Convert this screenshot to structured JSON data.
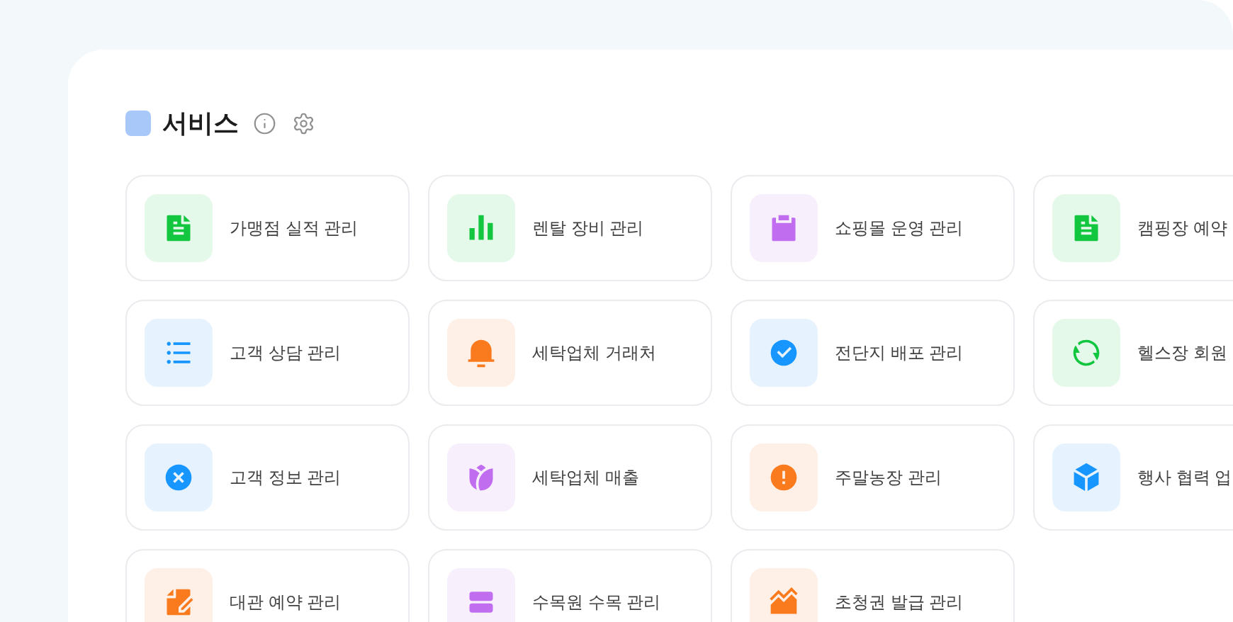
{
  "section": {
    "title": "서비스"
  },
  "services": [
    {
      "label": "가맹점 실적 관리",
      "kind": "document",
      "color": "#12c73f"
    },
    {
      "label": "렌탈 장비 관리",
      "kind": "bars",
      "color": "#12c73f"
    },
    {
      "label": "쇼핑몰 운영 관리",
      "kind": "clipboard",
      "color": "#c06df0"
    },
    {
      "label": "캠핑장 예약",
      "kind": "document",
      "color": "#12c73f"
    },
    {
      "label": "고객 상담 관리",
      "kind": "list",
      "color": "#1896ff"
    },
    {
      "label": "세탁업체 거래처",
      "kind": "bell",
      "color": "#fa7a1e"
    },
    {
      "label": "전단지 배포 관리",
      "kind": "check",
      "color": "#1896ff"
    },
    {
      "label": "헬스장 회원",
      "kind": "refresh",
      "color": "#12c73f"
    },
    {
      "label": "고객 정보 관리",
      "kind": "cross",
      "color": "#1896ff"
    },
    {
      "label": "세탁업체 매출",
      "kind": "flower",
      "color": "#c06df0"
    },
    {
      "label": "주말농장 관리",
      "kind": "alert",
      "color": "#fa7a1e"
    },
    {
      "label": "행사 협력 업",
      "kind": "cube",
      "color": "#1896ff"
    },
    {
      "label": "대관 예약 관리",
      "kind": "edit",
      "color": "#fa7a1e"
    },
    {
      "label": "수목원 수목 관리",
      "kind": "stack",
      "color": "#c06df0"
    },
    {
      "label": "초청권 발급 관리",
      "kind": "area",
      "color": "#fa7a1e"
    }
  ]
}
